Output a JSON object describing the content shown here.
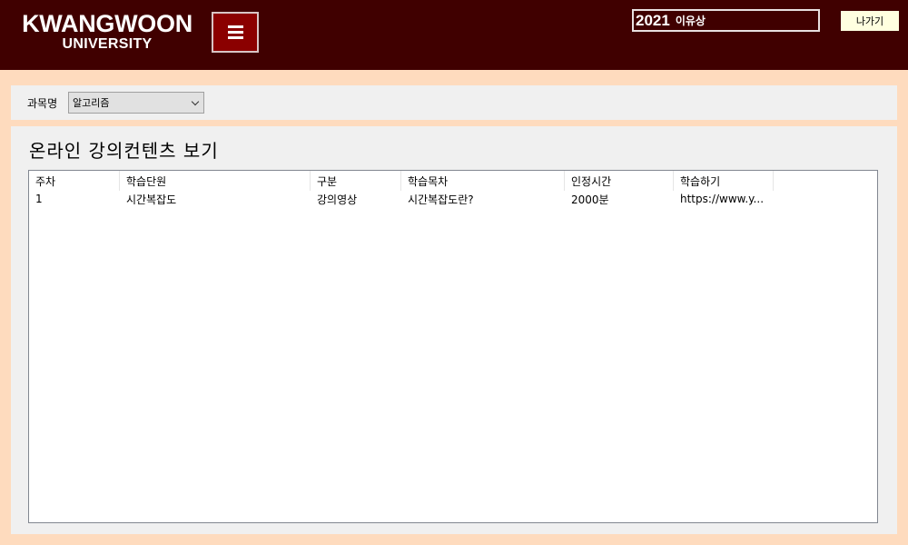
{
  "header": {
    "logo_line1": "KWANGWOON",
    "logo_line2": "UNIVERSITY",
    "user_year": "2021",
    "user_name": "이유상",
    "exit_label": "나가기",
    "background_color": "#400000",
    "menu_icon": "hamburger-menu-icon"
  },
  "course": {
    "label": "과목명",
    "selected": "알고리즘"
  },
  "content": {
    "title": "온라인 강의컨텐츠 보기",
    "columns": [
      "주차",
      "학습단원",
      "구분",
      "학습목차",
      "인정시간",
      "학습하기"
    ],
    "rows": [
      [
        "1",
        "시간복잡도",
        "강의영상",
        "시간복잡도란?",
        "2000분",
        "https://www.y..."
      ]
    ]
  }
}
